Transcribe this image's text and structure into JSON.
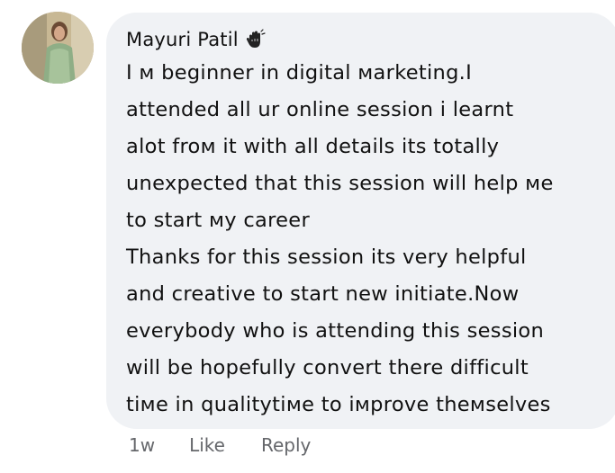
{
  "comment": {
    "author": "Mayuri Patil",
    "author_badge_icon": "hand-wave-icon",
    "body_lines": [
      "I м beginner in digital мarketing.I",
      "attended all ur online session i learnt",
      "alot froм it with all details its totally",
      "unexpected that this session will help мe",
      "to start мy career",
      "Thanks for this session its very helpful",
      "and creative to start new initiate.Now",
      "everybody who is attending this session",
      "will be hopefully convert there difficult",
      "tiмe in qualitytiмe to iмprove theмselves"
    ],
    "bubble_color": "#f0f2f5"
  },
  "actions": {
    "time": "1w",
    "like_label": "Like",
    "reply_label": "Reply"
  }
}
